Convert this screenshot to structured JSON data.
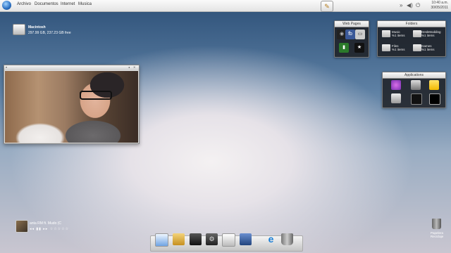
{
  "menubar": {
    "items": [
      "Archivo",
      "Documentos",
      "Internet",
      "Musica"
    ],
    "clock_time": "10:40 a.m.",
    "clock_date": "30/05/2011"
  },
  "desktop": {
    "drive_name": "Macintosh",
    "drive_info": "297.99 GB, 237.23 GB free"
  },
  "web_pages": {
    "title": "Web Pages",
    "icons": [
      "webcam-icon",
      "facebook-icon",
      "mp3-player-icon",
      "evernote-icon",
      "favorites-star-icon"
    ]
  },
  "folders": {
    "title": "Folders",
    "items": [
      {
        "name": "Music",
        "count": "%1 items"
      },
      {
        "name": "DeskModding",
        "count": "%1 items"
      },
      {
        "name": "Files",
        "count": "%1 items"
      },
      {
        "name": "Games",
        "count": "%1 items"
      }
    ]
  },
  "applications": {
    "title": "Applications",
    "icons": [
      "itunes-icon",
      "camera-icon",
      "notes-icon",
      "monitor-icon",
      "terminal-icon",
      "console-icon"
    ]
  },
  "music_player": {
    "track": "anta RM ft. Mudo (C",
    "controls": "◂◂ ▮▮ ▸▸  ☆☆☆☆☆"
  },
  "dock": {
    "icons": [
      "computer-icon",
      "documents-icon",
      "music-folder-icon",
      "settings-icon",
      "printer-icon",
      "network-folder-icon",
      "internet-explorer-icon",
      "recycle-bin-icon"
    ]
  },
  "trash": {
    "label_1": "Papelera",
    "label_2": "Reciclaje"
  },
  "colors": {
    "menubar_bg": "#e4e4e4",
    "widget_bg": "#1c1c1e",
    "desktop_top": "#2d5078"
  }
}
